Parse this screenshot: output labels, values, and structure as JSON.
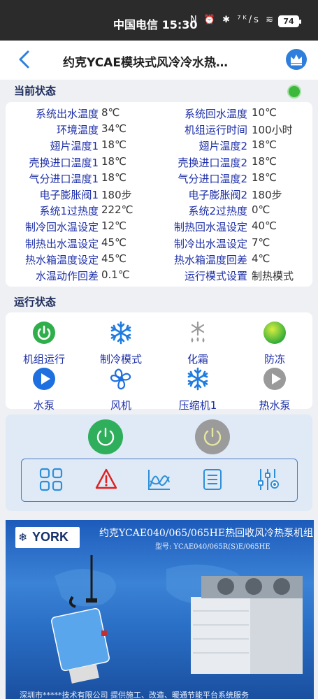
{
  "statusbar": {
    "carrier_time": "中国电信 15:30",
    "icons": "N ⏰ ✱ ⁷ᴷ/s ≋ ⁵ᴳ",
    "battery": "74"
  },
  "appbar": {
    "title": "约克YCAE模块式风冷冷水热…"
  },
  "current_status": {
    "title": "当前状态",
    "rows": [
      {
        "l1": "系统出水温度",
        "v1": "8℃",
        "l2": "系统回水温度",
        "v2": "10℃"
      },
      {
        "l1": "环境温度",
        "v1": "34℃",
        "l2": "机组运行时间",
        "v2": "100小时"
      },
      {
        "l1": "翅片温度1",
        "v1": "18℃",
        "l2": "翅片温度2",
        "v2": "18℃"
      },
      {
        "l1": "壳换进口温度1",
        "v1": "18℃",
        "l2": "壳换进口温度2",
        "v2": "18℃"
      },
      {
        "l1": "气分进口温度1",
        "v1": "18℃",
        "l2": "气分进口温度2",
        "v2": "18℃"
      },
      {
        "l1": "电子膨胀阀1",
        "v1": "180步",
        "l2": "电子膨胀阀2",
        "v2": "180步"
      },
      {
        "l1": "系统1过热度",
        "v1": "222℃",
        "l2": "系统2过热度",
        "v2": "0℃"
      },
      {
        "l1": "制冷回水温设定",
        "v1": "12℃",
        "l2": "制热回水温设定",
        "v2": "40℃"
      },
      {
        "l1": "制热出水温设定",
        "v1": "45℃",
        "l2": "制冷出水温设定",
        "v2": "7℃"
      },
      {
        "l1": "热水箱温度设定",
        "v1": "45℃",
        "l2": "热水箱温度回差",
        "v2": "4℃"
      },
      {
        "l1": "水温动作回差",
        "v1": "0.1℃",
        "l2": "运行模式设置",
        "v2": "制热模式"
      }
    ]
  },
  "run_status": {
    "title": "运行状态",
    "items": [
      {
        "label": "机组运行",
        "icon": "power-on-icon"
      },
      {
        "label": "制冷模式",
        "icon": "snowflake-icon"
      },
      {
        "label": "化霜",
        "icon": "defrost-icon"
      },
      {
        "label": "防冻",
        "icon": "antifreeze-icon"
      },
      {
        "label": "水泵",
        "icon": "play-icon"
      },
      {
        "label": "风机",
        "icon": "fan-icon"
      },
      {
        "label": "压缩机1",
        "icon": "snowflake-icon"
      },
      {
        "label": "热水泵",
        "icon": "play-icon"
      }
    ]
  },
  "banner": {
    "brand": "YORK",
    "title": "约克YCAE040/065/065HE热回收风冷热泵机组",
    "model": "型号: YCAE040/065R(S)E/065HE",
    "footer": "深圳市*****技术有限公司  提供施工、改造、暖通节能平台系统服务"
  },
  "colors": {
    "accent": "#2e7fdc",
    "label_blue": "#1d2fa8",
    "green": "#3cb83c",
    "red": "#e02020"
  }
}
